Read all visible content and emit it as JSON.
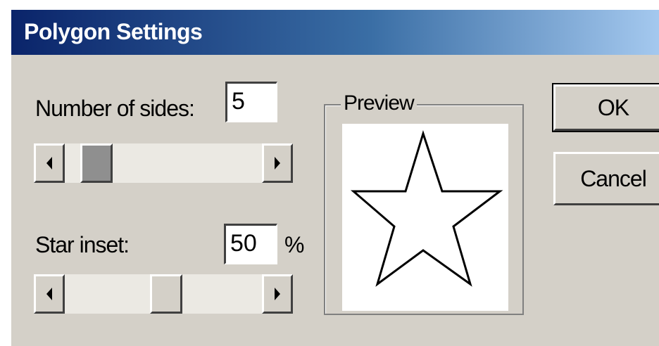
{
  "window": {
    "title": "Polygon Settings"
  },
  "sides": {
    "label": "Number of sides:",
    "value": "5",
    "slider_fraction": 0.06
  },
  "inset": {
    "label": "Star inset:",
    "value": "50",
    "unit": "%",
    "slider_fraction": 0.5
  },
  "preview": {
    "label": "Preview",
    "shape_icon": "star-icon"
  },
  "buttons": {
    "ok": "OK",
    "cancel": "Cancel"
  },
  "colors": {
    "titlebar_start": "#0a246a",
    "titlebar_end": "#a6caf0",
    "face": "#d4d0c8"
  }
}
